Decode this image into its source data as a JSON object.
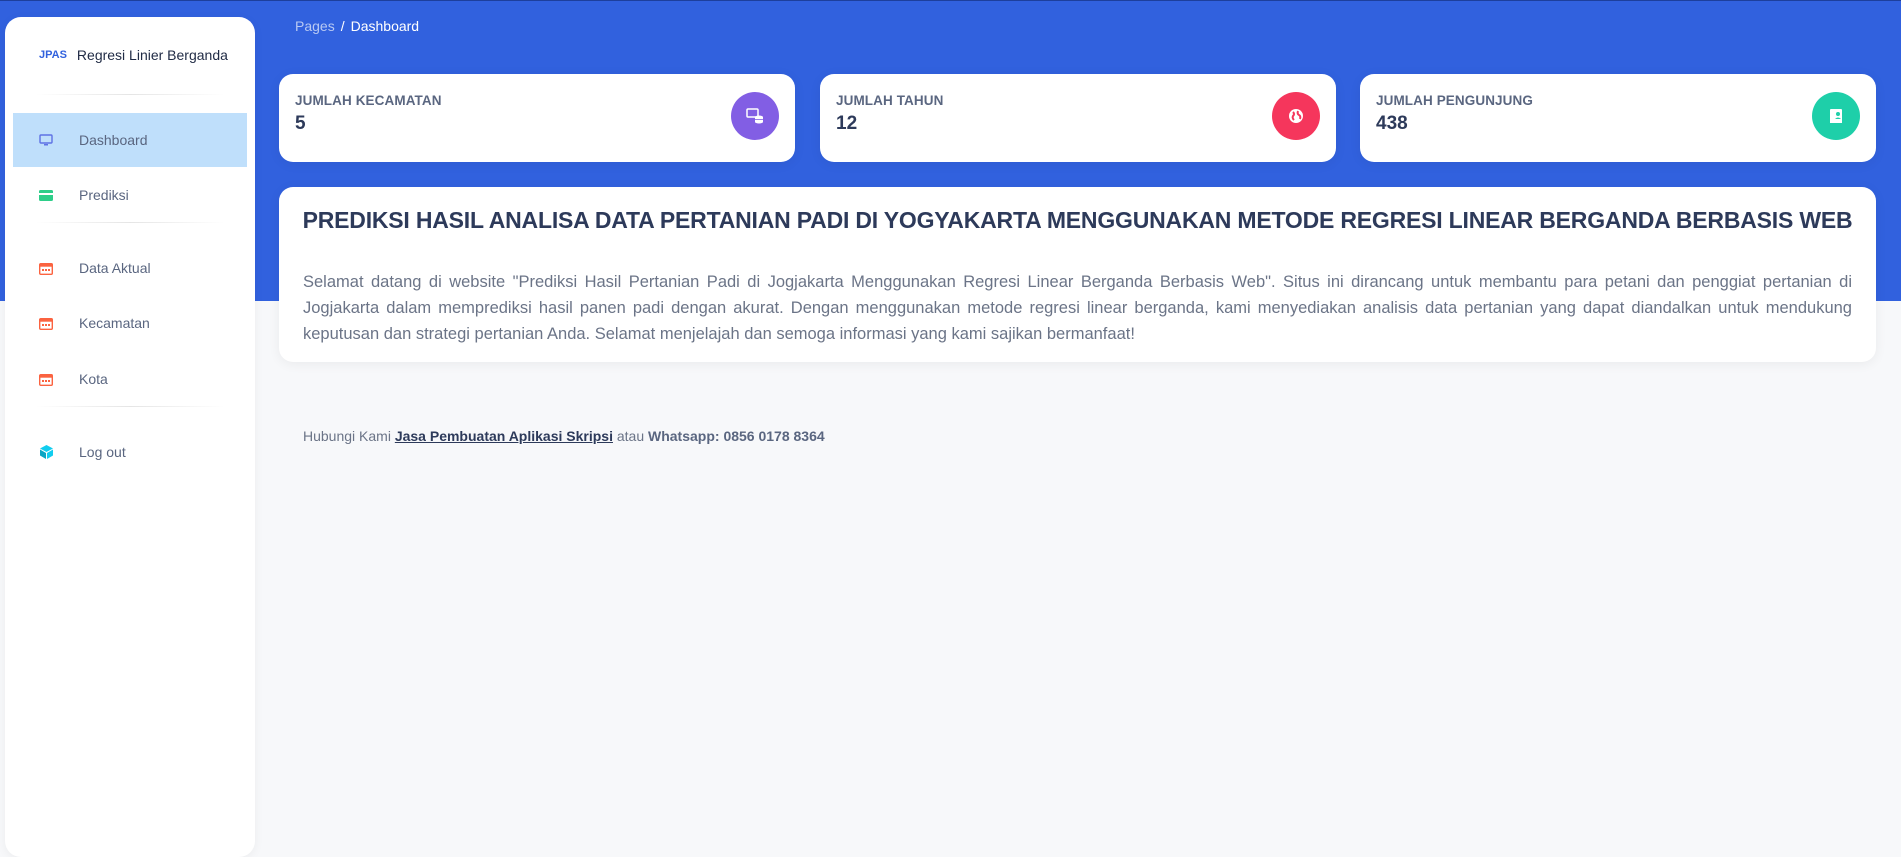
{
  "sidebar": {
    "logo": "JPAS",
    "app_name": "Regresi Linier Berganda",
    "items": [
      {
        "label": "Dashboard",
        "icon": "monitor-icon",
        "color": "#5e72e4"
      },
      {
        "label": "Prediksi",
        "icon": "credit-card-icon",
        "color": "#2dce89"
      },
      {
        "label": "Data Aktual",
        "icon": "calendar-icon",
        "color": "#fb6340"
      },
      {
        "label": "Kecamatan",
        "icon": "calendar-icon",
        "color": "#fb6340"
      },
      {
        "label": "Kota",
        "icon": "calendar-icon",
        "color": "#fb6340"
      },
      {
        "label": "Log out",
        "icon": "box-icon",
        "color": "#11cdef"
      }
    ]
  },
  "breadcrumb": {
    "parent": "Pages",
    "separator": "/",
    "current": "Dashboard"
  },
  "cards": [
    {
      "title": "JUMLAH KECAMATAN",
      "value": "5",
      "icon": "database-icon",
      "color": "#825ee4"
    },
    {
      "title": "JUMLAH TAHUN",
      "value": "12",
      "icon": "globe-icon",
      "color": "#f5365c"
    },
    {
      "title": "JUMLAH PENGUNJUNG",
      "value": "438",
      "icon": "user-card-icon",
      "color": "#1ecfa9"
    }
  ],
  "panel": {
    "title": "PREDIKSI HASIL ANALISA DATA PERTANIAN PADI DI YOGYAKARTA MENGGUNAKAN METODE REGRESI LINEAR BERGANDA BERBASIS WEB",
    "text": "Selamat datang di website \"Prediksi Hasil Pertanian Padi di Jogjakarta Menggunakan Regresi Linear Berganda Berbasis Web\". Situs ini dirancang untuk membantu para petani dan penggiat pertanian di Jogjakarta dalam memprediksi hasil panen padi dengan akurat. Dengan menggunakan metode regresi linear berganda, kami menyediakan analisis data pertanian yang dapat diandalkan untuk mendukung keputusan dan strategi pertanian Anda. Selamat menjelajah dan semoga informasi yang kami sajikan bermanfaat!"
  },
  "footer": {
    "prefix": "Hubungi Kami",
    "link": "Jasa Pembuatan Aplikasi Skripsi",
    "middle": "atau",
    "contact": "Whatsapp: 0856 0178 8364"
  },
  "colors": {
    "header_blue": "#3161de",
    "active_nav_bg": "#bfdffb"
  }
}
